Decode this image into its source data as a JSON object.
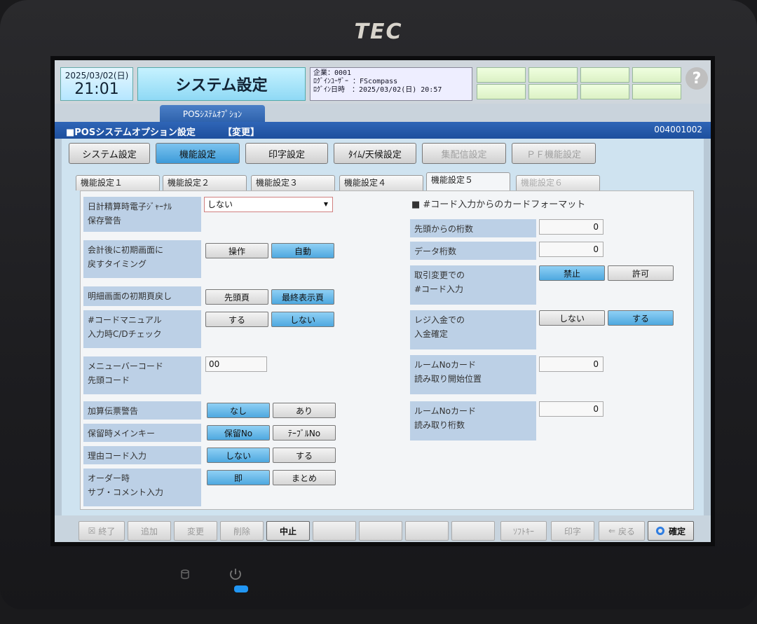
{
  "device": {
    "brand": "TEC"
  },
  "header": {
    "date": "2025/03/02(日)",
    "time": "21:01",
    "title": "システム設定",
    "info_lines": [
      "企業：0001",
      "ﾛｸﾞｲﾝﾕｰｻﾞｰ ：FScompass",
      "ﾛｸﾞｲﾝ日時　：2025/03/02(日) 20:57"
    ],
    "help": "?"
  },
  "breadcrumb_tab": "POSｼｽﾃﾑｵﾌﾟｼｮﾝ",
  "section_bar": {
    "title": "■POSシステムオプション設定",
    "mode": "【変更】",
    "code": "004001002"
  },
  "main_buttons": [
    {
      "label": "システム設定"
    },
    {
      "label": "機能設定"
    },
    {
      "label": "印字設定"
    },
    {
      "label": "ﾀｲﾑ/天候設定"
    },
    {
      "label": "集配信設定"
    },
    {
      "label": "ＰＦ機能設定"
    }
  ],
  "sub_tabs": [
    {
      "label": "機能設定１"
    },
    {
      "label": "機能設定２"
    },
    {
      "label": "機能設定３"
    },
    {
      "label": "機能設定４"
    },
    {
      "label": "機能設定５"
    },
    {
      "label": "機能設定６"
    }
  ],
  "left": {
    "journal_warning": {
      "label_l1": "日計精算時電子ｼﾞｬｰﾅﾙ",
      "label_l2": "保存警告",
      "value": "しない"
    },
    "return_timing": {
      "label_l1": "会計後に初期画面に",
      "label_l2": "戻すタイミング",
      "opt1": "操作",
      "opt2": "自動"
    },
    "detail_page": {
      "label": "明細画面の初期頁戻し",
      "opt1": "先頭頁",
      "opt2": "最終表示頁"
    },
    "cd_check": {
      "label_l1": "#コードマニュアル",
      "label_l2": "入力時C/Dチェック",
      "opt1": "する",
      "opt2": "しない"
    },
    "menu_bar": {
      "label_l1": "メニューバーコード",
      "label_l2": "先頭コード",
      "value": "00"
    },
    "add_slip": {
      "label": "加算伝票警告",
      "opt1": "なし",
      "opt2": "あり"
    },
    "hold_main": {
      "label": "保留時メインキー",
      "opt1": "保留No",
      "opt2": "ﾃｰﾌﾞﾙNo"
    },
    "reason_code": {
      "label": "理由コード入力",
      "opt1": "しない",
      "opt2": "する"
    },
    "order_comment": {
      "label_l1": "オーダー時",
      "label_l2": "サブ・コメント入力",
      "opt1": "即",
      "opt2": "まとめ"
    }
  },
  "right": {
    "heading": "■ #コード入力からのカードフォーマット",
    "from_head": {
      "label": "先頭からの桁数",
      "value": "0"
    },
    "data_digits": {
      "label": "データ桁数",
      "value": "0"
    },
    "trans_change": {
      "label_l1": "取引変更での",
      "label_l2": "#コード入力",
      "opt1": "禁止",
      "opt2": "許可"
    },
    "register_deposit": {
      "label_l1": "レジ入金での",
      "label_l2": "入金確定",
      "opt1": "しない",
      "opt2": "する"
    },
    "room_start": {
      "label_l1": "ルームNoカード",
      "label_l2": "読み取り開始位置",
      "value": "0"
    },
    "room_digits": {
      "label_l1": "ルームNoカード",
      "label_l2": "読み取り桁数",
      "value": "0"
    }
  },
  "footer": {
    "end": "終了",
    "add": "追加",
    "change": "変更",
    "delete": "削除",
    "cancel": "中止",
    "softkey": "ｿﾌﾄｷｰ",
    "print": "印字",
    "back": "戻る",
    "confirm": "確定"
  },
  "colors": {
    "active_button": "#4ea8df",
    "section_bar": "#1d4f9d",
    "label_bg": "#bcd0e6",
    "power_led": "#2196f3"
  }
}
